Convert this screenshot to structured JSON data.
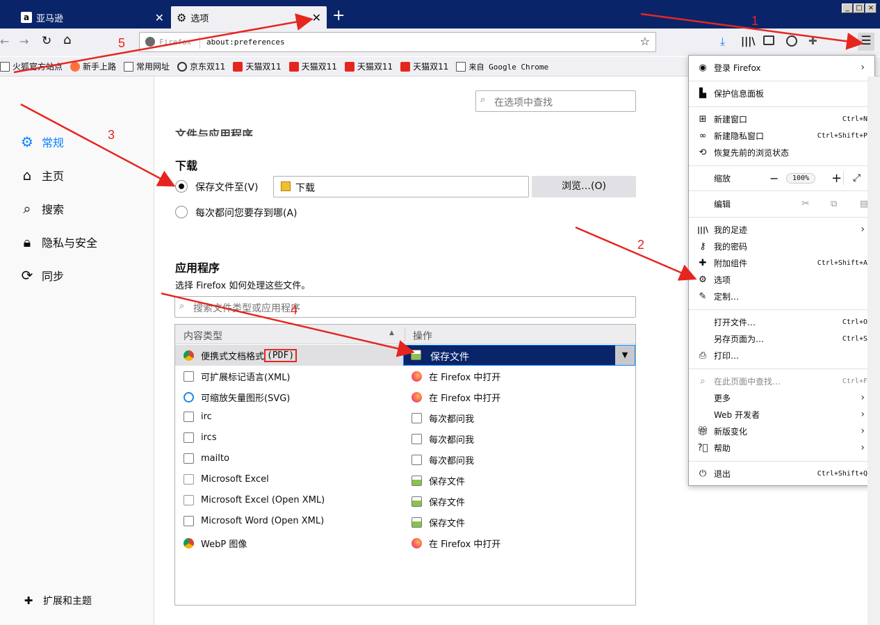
{
  "tabs": [
    {
      "label": "亚马逊",
      "close": "✕"
    },
    {
      "label": "选项",
      "close": "✕"
    }
  ],
  "new_tab": "+",
  "url": {
    "prefix": "Firefox",
    "value": "about:preferences"
  },
  "bookmarks": [
    "火狐官方站点",
    "新手上路",
    "常用网址",
    "京东双11",
    "天猫双11",
    "天猫双11",
    "天猫双11",
    "天猫双11",
    "来自 Google Chrome"
  ],
  "sidebar": {
    "items": [
      "常规",
      "主页",
      "搜索",
      "隐私与安全",
      "同步"
    ],
    "footer": "扩展和主题"
  },
  "search_placeholder": "在选项中查找",
  "cut_heading": "文件与应用程序",
  "download": {
    "heading": "下载",
    "save_to": "保存文件至(V)",
    "folder": "下载",
    "browse": "浏览…(O)",
    "ask": "每次都问您要存到哪(A)"
  },
  "apps": {
    "heading": "应用程序",
    "desc": "选择 Firefox 如何处理这些文件。",
    "search_placeholder": "搜索文件类型或应用程序",
    "col_type": "内容类型",
    "col_action": "操作",
    "rows": [
      {
        "type": "便携式文档格式",
        "type_suffix": "(PDF)",
        "action": "保存文件",
        "ticon": "chrome",
        "aicon": "save"
      },
      {
        "type": "可扩展标记语言(XML)",
        "action": "在 Firefox 中打开",
        "ticon": "doc",
        "aicon": "firefox"
      },
      {
        "type": "可缩放矢量图形(SVG)",
        "action": "在 Firefox 中打开",
        "ticon": "ie",
        "aicon": "firefox"
      },
      {
        "type": "irc",
        "action": "每次都问我",
        "ticon": "ask",
        "aicon": "ask"
      },
      {
        "type": "ircs",
        "action": "每次都问我",
        "ticon": "ask",
        "aicon": "ask"
      },
      {
        "type": "mailto",
        "action": "每次都问我",
        "ticon": "ask",
        "aicon": "ask"
      },
      {
        "type": "Microsoft Excel",
        "action": "保存文件",
        "ticon": "blank",
        "aicon": "save"
      },
      {
        "type": "Microsoft Excel (Open XML)",
        "action": "保存文件",
        "ticon": "blank",
        "aicon": "save"
      },
      {
        "type": "Microsoft Word (Open XML)",
        "action": "保存文件",
        "ticon": "doc",
        "aicon": "save"
      },
      {
        "type": "WebP 图像",
        "action": "在 Firefox 中打开",
        "ticon": "chrome",
        "aicon": "firefox"
      }
    ]
  },
  "menu": {
    "login": "登录 Firefox",
    "protect": "保护信息面板",
    "new_window": "新建窗口",
    "new_window_sc": "Ctrl+N",
    "private": "新建隐私窗口",
    "private_sc": "Ctrl+Shift+P",
    "restore": "恢复先前的浏览状态",
    "zoom": "缩放",
    "zoom_minus": "−",
    "zoom_value": "100%",
    "zoom_plus": "+",
    "edit": "编辑",
    "library": "我的足迹",
    "passwords": "我的密码",
    "addons": "附加组件",
    "addons_sc": "Ctrl+Shift+A",
    "options": "选项",
    "customize": "定制…",
    "open_file": "打开文件…",
    "open_file_sc": "Ctrl+O",
    "save_as": "另存页面为…",
    "save_as_sc": "Ctrl+S",
    "print": "打印…",
    "find": "在此页面中查找…",
    "find_sc": "Ctrl+F",
    "more": "更多",
    "webdev": "Web 开发者",
    "whatsnew": "新版变化",
    "help": "帮助",
    "quit": "退出",
    "quit_sc": "Ctrl+Shift+Q"
  },
  "annotations": [
    "1",
    "2",
    "3",
    "4",
    "5"
  ],
  "colors": {
    "titlebar": "#0a246a",
    "arrow": "#e5261f",
    "selected": "#0a246a",
    "accent": "#0a84ff"
  }
}
